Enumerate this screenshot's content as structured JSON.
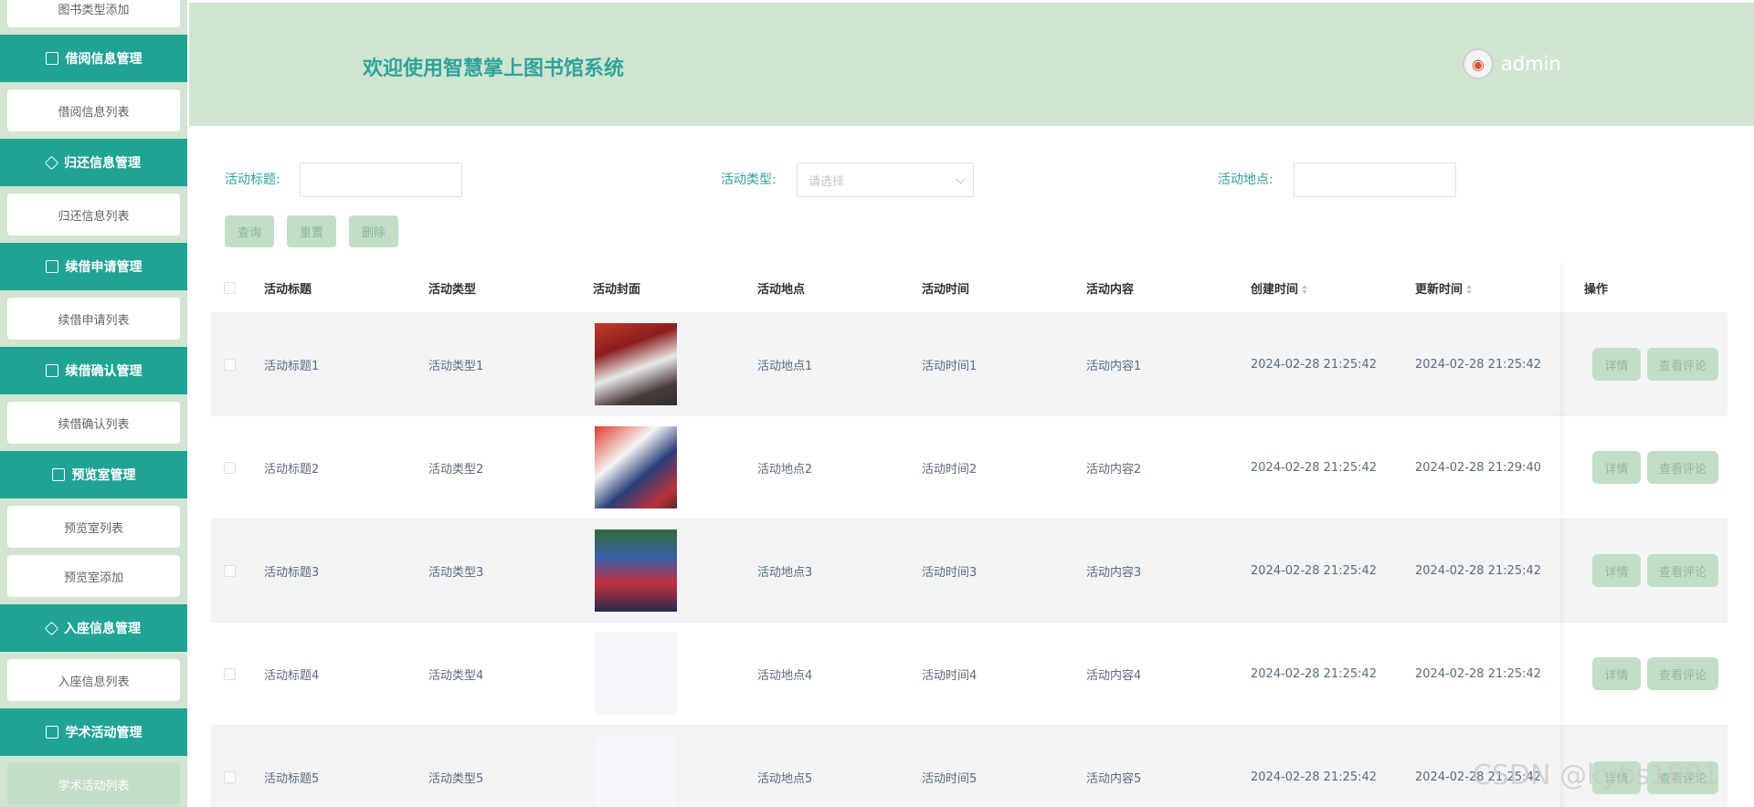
{
  "sidebar": {
    "items": [
      {
        "type": "item",
        "label": "图书类型添加"
      },
      {
        "type": "head",
        "label": "借阅信息管理",
        "icon": "edit-icon"
      },
      {
        "type": "item",
        "label": "借阅信息列表"
      },
      {
        "type": "head",
        "label": "归还信息管理",
        "icon": "diamond-icon"
      },
      {
        "type": "item",
        "label": "归还信息列表"
      },
      {
        "type": "head",
        "label": "续借申请管理",
        "icon": "chart-icon"
      },
      {
        "type": "item",
        "label": "续借申请列表"
      },
      {
        "type": "head",
        "label": "续借确认管理",
        "icon": "check-doc-icon"
      },
      {
        "type": "item",
        "label": "续借确认列表"
      },
      {
        "type": "head",
        "label": "预览室管理",
        "icon": "edit-icon"
      },
      {
        "type": "item",
        "label": "预览室列表"
      },
      {
        "type": "item",
        "label": "预览室添加"
      },
      {
        "type": "head",
        "label": "入座信息管理",
        "icon": "diamond-icon"
      },
      {
        "type": "item",
        "label": "入座信息列表"
      },
      {
        "type": "head",
        "label": "学术活动管理",
        "icon": "edit-icon"
      },
      {
        "type": "item",
        "label": "学术活动列表",
        "active": true
      }
    ]
  },
  "header": {
    "title": "欢迎使用智慧掌上图书馆系统",
    "username": "admin"
  },
  "search": {
    "title_label": "活动标题:",
    "title_value": "",
    "type_label": "活动类型:",
    "type_placeholder": "请选择",
    "place_label": "活动地点:",
    "place_value": ""
  },
  "buttons": {
    "query": "查询",
    "reset": "重置",
    "delete": "删除"
  },
  "table": {
    "columns": [
      "活动标题",
      "活动类型",
      "活动封面",
      "活动地点",
      "活动时间",
      "活动内容",
      "创建时间",
      "更新时间",
      "操作"
    ],
    "rows": [
      {
        "title": "活动标题1",
        "type": "活动类型1",
        "place": "活动地点1",
        "time": "活动时间1",
        "content": "活动内容1",
        "created": "2024-02-28 21:25:42",
        "updated": "2024-02-28 21:25:42"
      },
      {
        "title": "活动标题2",
        "type": "活动类型2",
        "place": "活动地点2",
        "time": "活动时间2",
        "content": "活动内容2",
        "created": "2024-02-28 21:25:42",
        "updated": "2024-02-28 21:29:40"
      },
      {
        "title": "活动标题3",
        "type": "活动类型3",
        "place": "活动地点3",
        "time": "活动时间3",
        "content": "活动内容3",
        "created": "2024-02-28 21:25:42",
        "updated": "2024-02-28 21:25:42"
      },
      {
        "title": "活动标题4",
        "type": "活动类型4",
        "place": "活动地点4",
        "time": "活动时间4",
        "content": "活动内容4",
        "created": "2024-02-28 21:25:42",
        "updated": "2024-02-28 21:25:42"
      },
      {
        "title": "活动标题5",
        "type": "活动类型5",
        "place": "活动地点5",
        "time": "活动时间5",
        "content": "活动内容5",
        "created": "2024-02-28 21:25:42",
        "updated": "2024-02-28 21:25:42"
      }
    ],
    "action_detail": "详情",
    "action_comments": "查看评论"
  },
  "watermark": "CSDN @kybs1991",
  "colors": {
    "accent": "#1fa394",
    "header_bg": "#cfe5cf",
    "button_bg": "#c2dec6"
  }
}
